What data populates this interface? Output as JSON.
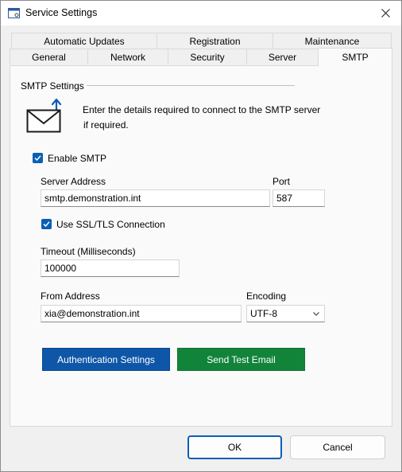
{
  "window": {
    "title": "Service Settings"
  },
  "tabs": {
    "row1": [
      "Automatic Updates",
      "Registration",
      "Maintenance"
    ],
    "row2": [
      "General",
      "Network",
      "Security",
      "Server",
      "SMTP"
    ],
    "active": "SMTP"
  },
  "smtp": {
    "group_label": "SMTP Settings",
    "description_line1": "Enter the details required to connect to the SMTP server",
    "description_line2": "if required.",
    "enable_label": "Enable SMTP",
    "enable_checked": true,
    "server_address_label": "Server Address",
    "server_address_value": "smtp.demonstration.int",
    "port_label": "Port",
    "port_value": "587",
    "ssl_label": "Use SSL/TLS Connection",
    "ssl_checked": true,
    "timeout_label": "Timeout (Milliseconds)",
    "timeout_value": "100000",
    "from_label": "From Address",
    "from_value": "xia@demonstration.int",
    "encoding_label": "Encoding",
    "encoding_value": "UTF-8",
    "auth_button": "Authentication Settings",
    "test_button": "Send Test Email"
  },
  "footer": {
    "ok": "OK",
    "cancel": "Cancel"
  },
  "colors": {
    "accent": "#0a5fb5",
    "blue_button": "#0e56a8",
    "green_button": "#12843a"
  }
}
